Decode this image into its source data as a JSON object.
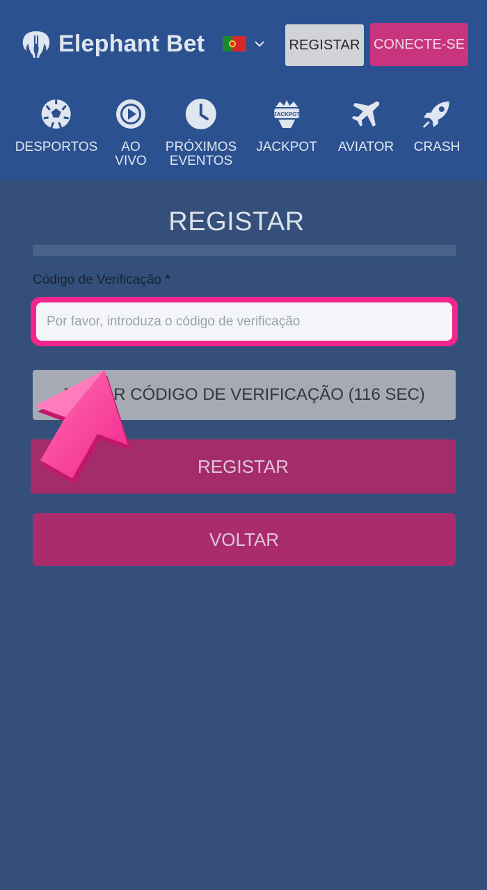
{
  "header": {
    "brand": "Elephant Bet",
    "register_label": "REGISTAR",
    "connect_label": "CONECTE-SE",
    "language_flag": "flag-portugal"
  },
  "nav": {
    "items": [
      {
        "label": "DESPORTOS",
        "icon": "soccer-ball-icon"
      },
      {
        "label": "AO\nVIVO",
        "icon": "play-circle-icon"
      },
      {
        "label": "PRÓXIMOS\nEVENTOS",
        "icon": "clock-icon"
      },
      {
        "label": "JACKPOT",
        "icon": "jackpot-icon"
      },
      {
        "label": "AVIATOR",
        "icon": "airplane-icon"
      },
      {
        "label": "CRASH",
        "icon": "rocket-icon"
      }
    ]
  },
  "form": {
    "title": "REGISTAR",
    "code_label": "Código de Verificação *",
    "code_placeholder": "Por favor, introduza o código de verificação",
    "code_value": "",
    "send_code_label": "ENVIAR CÓDIGO DE VERIFICAÇÃO (116 SEC)",
    "register_label": "REGISTAR",
    "back_label": "VOLTAR"
  },
  "colors": {
    "header_bg": "#2c5191",
    "page_bg": "#34507a",
    "accent_pink": "#f2268d",
    "button_magenta": "#a52c6b"
  }
}
